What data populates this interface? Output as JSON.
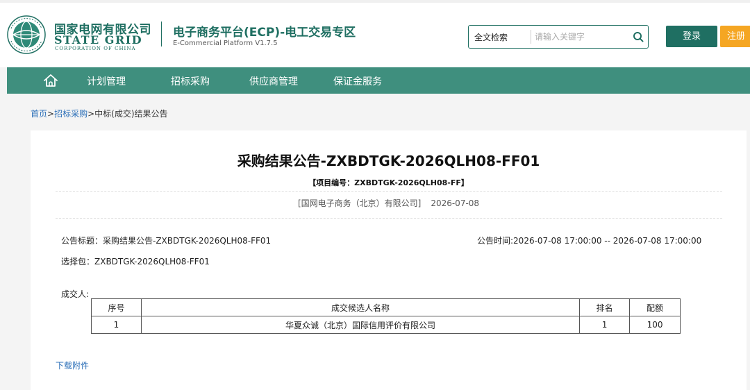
{
  "brand": {
    "name_cn": "国家电网有限公司",
    "name_en": "STATE GRID",
    "corporation": "CORPORATION OF CHINA",
    "platform_title": "电子商务平台(ECP)-电工交易专区",
    "platform_subtitle": "E-Commercial Platform V1.7.5",
    "accent_color": "#1f6f62"
  },
  "search": {
    "scope_label": "全文检索",
    "placeholder": "请输入关键字",
    "icon": "search-icon"
  },
  "header_buttons": {
    "login_label": "登录",
    "register_label": "注册"
  },
  "nav": {
    "home_icon": "home-icon",
    "items": [
      {
        "label": "计划管理"
      },
      {
        "label": "招标采购"
      },
      {
        "label": "供应商管理"
      },
      {
        "label": "保证金服务"
      }
    ]
  },
  "breadcrumb": {
    "home": "首页",
    "sep": ">",
    "procurement": "招标采购",
    "current": ">中标(成交)结果公告"
  },
  "notice": {
    "title": "采购结果公告-ZXBDTGK-2026QLH08-FF01",
    "project_no": "【项目编号：ZXBDTGK-2026QLH08-FF】",
    "publisher": "[国网电子商务（北京）有限公司]",
    "publish_date": "2026-07-08",
    "subject": "公告标题：采购结果公告-ZXBDTGK-2026QLH08-FF01",
    "time": "公告时间:2026-07-08 17:00:00 -- 2026-07-08 17:00:00",
    "package": "选择包：ZXBDTGK-2026QLH08-FF01",
    "winner_label": "成交人:",
    "download_label": "下载附件"
  },
  "award_table": {
    "headers": [
      "序号",
      "成交候选人名称",
      "排名",
      "配额"
    ],
    "rows": [
      [
        "1",
        "华夏众诚（北京）国际信用评价有限公司",
        "1",
        "100"
      ]
    ]
  }
}
